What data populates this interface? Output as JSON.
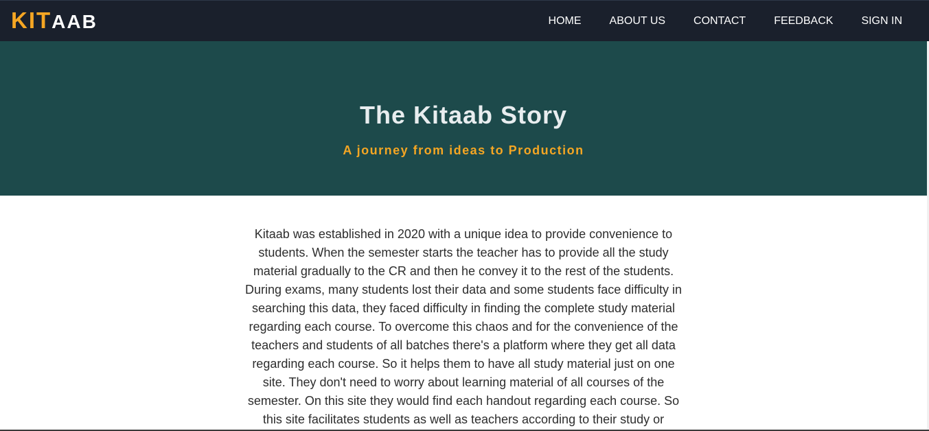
{
  "brand": {
    "part1": "KIT",
    "part2": "AAB",
    "accent_color": "#f5a623"
  },
  "nav": {
    "items": [
      {
        "label": "HOME"
      },
      {
        "label": "ABOUT US"
      },
      {
        "label": "CONTACT"
      },
      {
        "label": "FEEDBACK"
      },
      {
        "label": "SIGN IN"
      }
    ]
  },
  "hero": {
    "title": "The Kitaab Story",
    "subtitle": "A journey from ideas to Production",
    "background_color": "#1d4a4b"
  },
  "story": {
    "text": "Kitaab was established in 2020 with a unique idea to provide convenience to students. When the semester starts the teacher has to provide all the study material gradually to the CR and then he convey it to the rest of the students. During exams, many students lost their data and some students face difficulty in searching this data, they faced difficulty in finding the complete study material regarding each course. To overcome this chaos and for the convenience of the teachers and students of all batches there's a platform where they get all data regarding each course. So it helps them to have all study material just on one site. They don't need to worry about learning material of all courses of the semester. On this site they would find each handout regarding each course. So this site facilitates students as well as teachers according to their study or"
  }
}
